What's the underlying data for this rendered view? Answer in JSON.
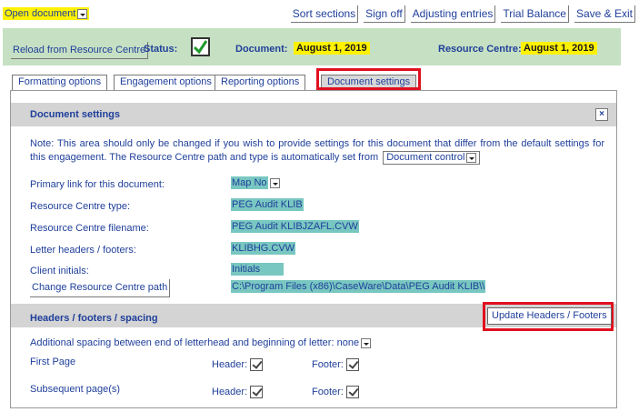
{
  "topbar": {
    "open_document": "Open document",
    "actions": [
      "Sort sections",
      "Sign off",
      "Adjusting entries",
      "Trial Balance",
      "Save & Exit"
    ]
  },
  "status_band": {
    "reload_label": "Reload from Resource Centre",
    "status_label": "Status:",
    "status_checked": true,
    "document_label": "Document:",
    "document_date": "August 1, 2019",
    "resource_centre_label": "Resource Centre:",
    "resource_centre_date": "August 1, 2019"
  },
  "tabs": [
    {
      "label": "Formatting options",
      "active": false
    },
    {
      "label": "Engagement options",
      "active": false
    },
    {
      "label": "Reporting options",
      "active": false
    },
    {
      "label": "Document settings",
      "active": true
    }
  ],
  "document_settings": {
    "title": "Document settings",
    "close_label": "×",
    "note": "Note: This area should only be changed if you wish to provide settings for this document that differ from the default settings for this engagement. The Resource Centre path and type is automatically set from",
    "note_dropdown": "Document control",
    "rows": [
      {
        "label": "Primary link for this document:",
        "value": "Map No"
      },
      {
        "label": "Resource Centre type:",
        "value": "PEG Audit KLIB"
      },
      {
        "label": "Resource Centre filename:",
        "value": "PEG Audit KLIBJZAFL.CVW"
      },
      {
        "label": "Letter headers / footers:",
        "value": "KLIBHG.CVW"
      },
      {
        "label": "Client initials:",
        "value": "Initials"
      }
    ],
    "change_path_label": "Change Resource Centre path",
    "path_value": "C:\\Program Files (x86)\\CaseWare\\Data\\PEG Audit KLIB\\\\"
  },
  "headers_footers": {
    "title": "Headers / footers / spacing",
    "update_label": "Update Headers / Footers",
    "spacing_label": "Additional spacing between end of letterhead and beginning of letter:",
    "spacing_value": "none",
    "first_page_label": "First Page",
    "subsequent_label": "Subsequent page(s)",
    "header_label": "Header:",
    "footer_label": "Footer:"
  },
  "colors": {
    "status_band": "#c6e0c3",
    "highlight": "#fff200",
    "field": "#79c7c1",
    "callout": "#e0101f",
    "link": "#1f3f9a"
  }
}
